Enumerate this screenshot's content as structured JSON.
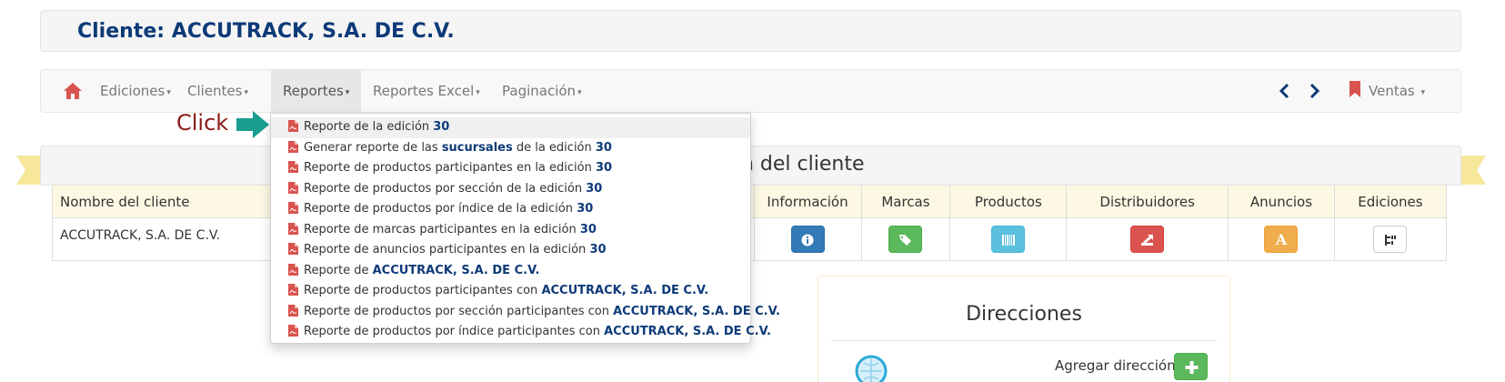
{
  "header": {
    "client_title": "Cliente: ACCUTRACK, S.A. DE C.V."
  },
  "nav": {
    "home_icon": "home-icon",
    "items": [
      {
        "label": "Ediciones"
      },
      {
        "label": "Clientes"
      },
      {
        "label": "Reportes"
      },
      {
        "label": "Reportes Excel"
      },
      {
        "label": "Paginación"
      }
    ],
    "ventas_label": "Ventas",
    "colors": {
      "home": "#d9534f",
      "arrows": "#0d3a78",
      "bookmark": "#d9534f"
    }
  },
  "annotation": {
    "click_label": "Click",
    "arrow_color": "#1a9e8f"
  },
  "dropdown": {
    "items": [
      {
        "text": "Reporte de la edición ",
        "bold": "30"
      },
      {
        "text": "Generar reporte de las ",
        "bold_mid": "sucursales",
        "text2": " de la edición ",
        "bold": "30"
      },
      {
        "text": "Reporte de productos participantes en la edición ",
        "bold": "30"
      },
      {
        "text": "Reporte de productos por sección de la edición ",
        "bold": "30"
      },
      {
        "text": "Reporte de productos por índice de la edición ",
        "bold": "30"
      },
      {
        "text": "Reporte de marcas participantes en la edición ",
        "bold": "30"
      },
      {
        "text": "Reporte de anuncios participantes en la edición ",
        "bold": "30"
      },
      {
        "text": "Reporte de ",
        "bold": "ACCUTRACK, S.A. DE C.V."
      },
      {
        "text": "Reporte de productos participantes con ",
        "bold": "ACCUTRACK, S.A. DE C.V."
      },
      {
        "text": "Reporte de productos por sección participantes con ",
        "bold": "ACCUTRACK, S.A. DE C.V."
      },
      {
        "text": "Reporte de productos por índice participantes con ",
        "bold": "ACCUTRACK, S.A. DE C.V."
      }
    ]
  },
  "panel": {
    "title_visible_fragment": "n del cliente"
  },
  "table": {
    "headers": {
      "nombre": "Nombre del cliente",
      "informacion": "Información",
      "marcas": "Marcas",
      "productos": "Productos",
      "distribuidores": "Distribuidores",
      "anuncios": "Anuncios",
      "ediciones": "Ediciones"
    },
    "row": {
      "nombre": "ACCUTRACK, S.A. DE C.V.",
      "anuncios_glyph": "A"
    }
  },
  "direcciones": {
    "title": "Direcciones",
    "add_label": "Agregar dirección"
  }
}
